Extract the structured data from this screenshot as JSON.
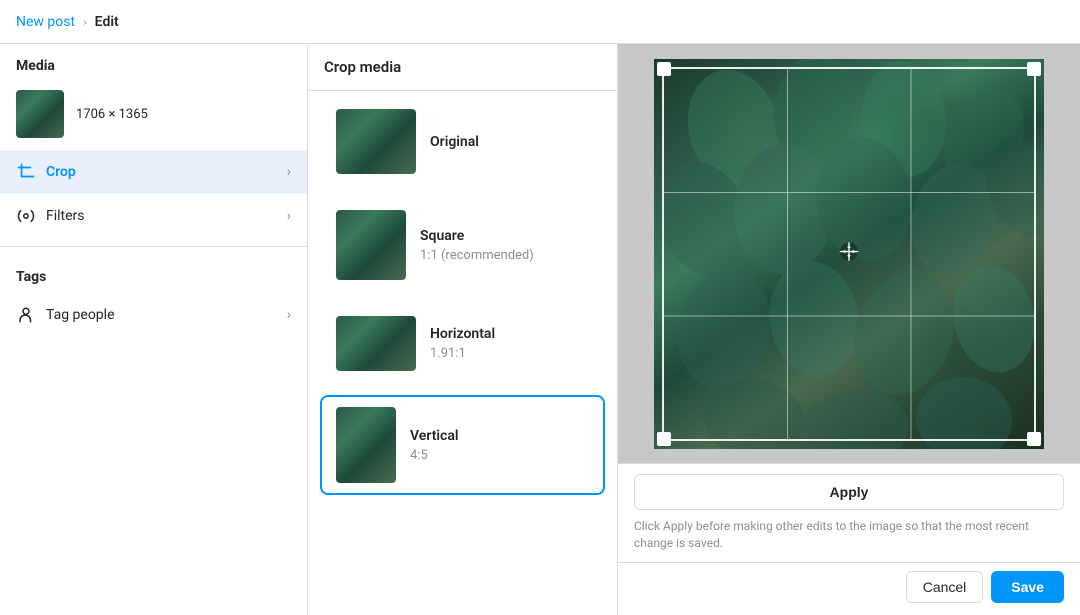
{
  "topbar": {
    "breadcrumb_link": "New post",
    "breadcrumb_separator": "›",
    "breadcrumb_current": "Edit"
  },
  "left_panel": {
    "media_section_title": "Media",
    "media_dimensions": "1706 × 1365",
    "nav_items": [
      {
        "id": "crop",
        "label": "Crop",
        "active": true,
        "icon": "crop"
      },
      {
        "id": "filters",
        "label": "Filters",
        "active": false,
        "icon": "filters"
      }
    ],
    "tags_section_title": "Tags",
    "tag_people_label": "Tag people"
  },
  "middle_panel": {
    "title": "Crop media",
    "options": [
      {
        "id": "original",
        "name": "Original",
        "ratio": "",
        "selected": false,
        "shape": "original"
      },
      {
        "id": "square",
        "name": "Square",
        "ratio": "1:1 (recommended)",
        "selected": false,
        "shape": "square"
      },
      {
        "id": "horizontal",
        "name": "Horizontal",
        "ratio": "1.91:1",
        "selected": false,
        "shape": "horizontal"
      },
      {
        "id": "vertical",
        "name": "Vertical",
        "ratio": "4:5",
        "selected": true,
        "shape": "vertical"
      }
    ]
  },
  "right_panel": {
    "apply_btn_label": "Apply",
    "apply_note": "Click Apply before making other edits to the image so that the most recent change is saved.",
    "cancel_label": "Cancel",
    "save_label": "Save"
  }
}
